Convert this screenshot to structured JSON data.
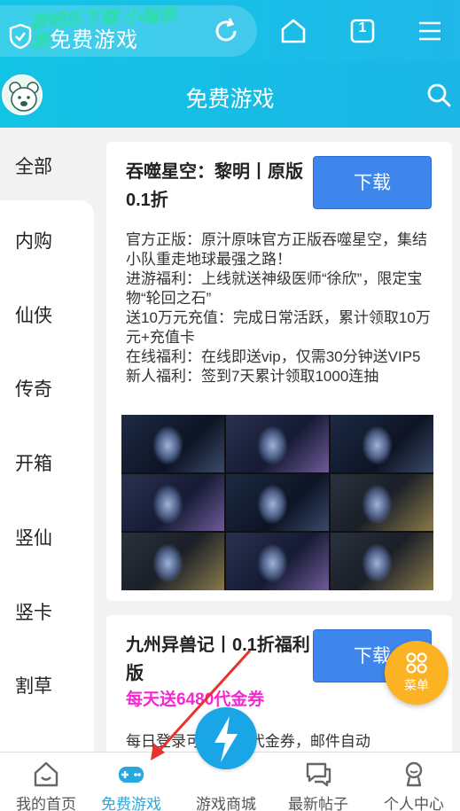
{
  "browser": {
    "url_title": "免费游戏",
    "watermark": "游吧乐下载 小编亲测",
    "tab_count": "1"
  },
  "header": {
    "title": "免费游戏"
  },
  "sidebar": {
    "items": [
      {
        "label": "全部"
      },
      {
        "label": "内购"
      },
      {
        "label": "仙侠"
      },
      {
        "label": "传奇"
      },
      {
        "label": "开箱"
      },
      {
        "label": "竖仙"
      },
      {
        "label": "竖卡"
      },
      {
        "label": "割草"
      }
    ]
  },
  "games": [
    {
      "title": "吞噬星空：黎明丨原版0.1折",
      "download_label": "下载",
      "description": "官方正版：原汁原味官方正版吞噬星空，集结小队重走地球最强之路！\n进游福利：上线就送神级医师“徐欣”，限定宝物“轮回之石”\n送10万元充值：完成日常活跃，累计领取10万元+充值卡\n在线福利：在线即送vip，仅需30分钟送VIP5\n新人福利：签到7天累计领取1000连抽"
    },
    {
      "title": "九州异兽记丨0.1折福利版",
      "download_label": "下载",
      "promo": "每天送6480代金券",
      "description": "每日登录可领6480代金券，邮件自动"
    }
  ],
  "float_menu": {
    "label": "菜单"
  },
  "bottom_nav": {
    "items": [
      {
        "label": "我的首页"
      },
      {
        "label": "免费游戏"
      },
      {
        "label": "游戏商城"
      },
      {
        "label": "最新帖子"
      },
      {
        "label": "个人中心"
      }
    ]
  },
  "colors": {
    "primary": "#1ab6e6",
    "download": "#3f86ec",
    "promo": "#f528d2",
    "float_menu": "#fbb323",
    "annotation_arrow": "#e8322d"
  }
}
